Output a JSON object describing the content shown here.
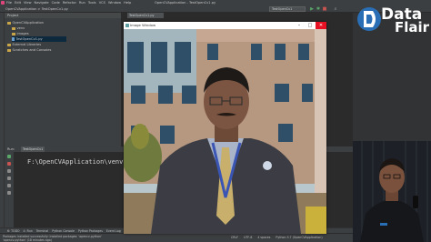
{
  "ide": {
    "menu": [
      "File",
      "Edit",
      "View",
      "Navigate",
      "Code",
      "Refactor",
      "Run",
      "Tools",
      "VCS",
      "Window",
      "Help"
    ],
    "window_title": "OpenCVApplication - TestOpenCv1.py",
    "breadcrumb": "OpenCVApplication  >  TestOpenCv1.py",
    "run_config": "TestOpenCv1",
    "editor_tab": "TestOpenCv1.py"
  },
  "project_panel": {
    "header": "Project",
    "items": [
      {
        "label": "OpenCVApplication",
        "type": "folder"
      },
      {
        "label": "venv",
        "type": "folder"
      },
      {
        "label": "images",
        "type": "folder"
      },
      {
        "label": "TestOpenCv1.py",
        "type": "file"
      },
      {
        "label": "External Libraries",
        "type": "folder"
      },
      {
        "label": "Scratches and Consoles",
        "type": "folder"
      }
    ]
  },
  "run_panel": {
    "label": "Run:",
    "tab": "TestOpenCv1",
    "console_line": "F:\\OpenCVApplication\\venv\\"
  },
  "tool_tabs": [
    "6: TODO",
    "4: Run",
    "Terminal",
    "Python Console",
    "Python Packages",
    "Event Log"
  ],
  "status": {
    "message": "Packages installed successfully: Installed packages: 'opencv-python'",
    "message2": "'opencv-python' (18 minutes ago)",
    "items": [
      "CRLF",
      "UTF-8",
      "4 spaces",
      "Python 3.7 (OpenCVApplication)"
    ]
  },
  "image_window": {
    "title": "Image Window",
    "minimize": "–",
    "maximize": "□",
    "close": "✕"
  },
  "logo": {
    "line1": "Data",
    "line2": "Flair"
  },
  "colors": {
    "ide_bg": "#2b2b2b",
    "panel_bg": "#3c3f41",
    "accent_close": "#e81123",
    "logo_blue": "#2a6fb5"
  }
}
